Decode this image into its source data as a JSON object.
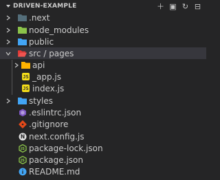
{
  "explorer": {
    "title": "DRIVEN-EXAMPLE",
    "actions": [
      {
        "name": "new-file-icon",
        "glyph": "＋"
      },
      {
        "name": "new-folder-icon",
        "glyph": "▣"
      },
      {
        "name": "refresh-icon",
        "glyph": "↻"
      },
      {
        "name": "collapse-all-icon",
        "glyph": "⊟"
      }
    ],
    "items": [
      {
        "label": ".next",
        "kind": "folder"
      },
      {
        "label": "node_modules",
        "kind": "folder"
      },
      {
        "label": "public",
        "kind": "folder"
      },
      {
        "label": "src / pages",
        "kind": "folder-open"
      },
      {
        "label": "api",
        "kind": "folder"
      },
      {
        "label": "_app.js",
        "kind": "js"
      },
      {
        "label": "index.js",
        "kind": "js"
      },
      {
        "label": "styles",
        "kind": "folder"
      },
      {
        "label": ".eslintrc.json",
        "kind": "eslint"
      },
      {
        "label": ".gitignore",
        "kind": "git"
      },
      {
        "label": "next.config.js",
        "kind": "next"
      },
      {
        "label": "package-lock.json",
        "kind": "node"
      },
      {
        "label": "package.json",
        "kind": "node"
      },
      {
        "label": "README.md",
        "kind": "info"
      }
    ]
  },
  "colors": {
    "background": "#252526",
    "selected_row": "#37373d",
    "folder": "#42a5f5",
    "folder_open": "#ffca28",
    "src_folder": "#4caf50",
    "js": "#f5de19",
    "text": "#cccccc"
  }
}
